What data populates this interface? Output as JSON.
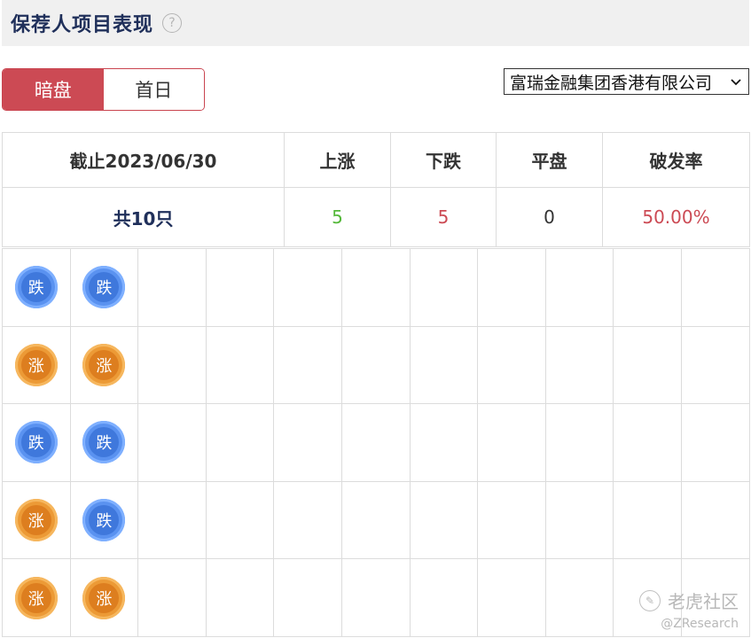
{
  "header": {
    "title": "保荐人项目表现",
    "help_glyph": "?"
  },
  "toggle": {
    "active_label": "暗盘",
    "inactive_label": "首日"
  },
  "sponsor_select": {
    "selected": "富瑞金融集团香港有限公司"
  },
  "summary": {
    "headers": [
      "截止2023/06/30",
      "上涨",
      "下跌",
      "平盘",
      "破发率"
    ],
    "total": "共10只",
    "up": "5",
    "down": "5",
    "flat": "0",
    "break_rate": "50.00%"
  },
  "colors": {
    "accent_red": "#cc4a54",
    "rise_green": "#54b83a",
    "coin_blue": "#5a92f0",
    "coin_orange": "#ec9a36"
  },
  "grid": {
    "rows": [
      [
        "跌",
        "跌"
      ],
      [
        "涨",
        "涨"
      ],
      [
        "跌",
        "跌"
      ],
      [
        "涨",
        "跌"
      ],
      [
        "涨",
        "涨"
      ]
    ]
  },
  "watermark": {
    "brand": "老虎社区",
    "handle": "@ZResearch"
  }
}
